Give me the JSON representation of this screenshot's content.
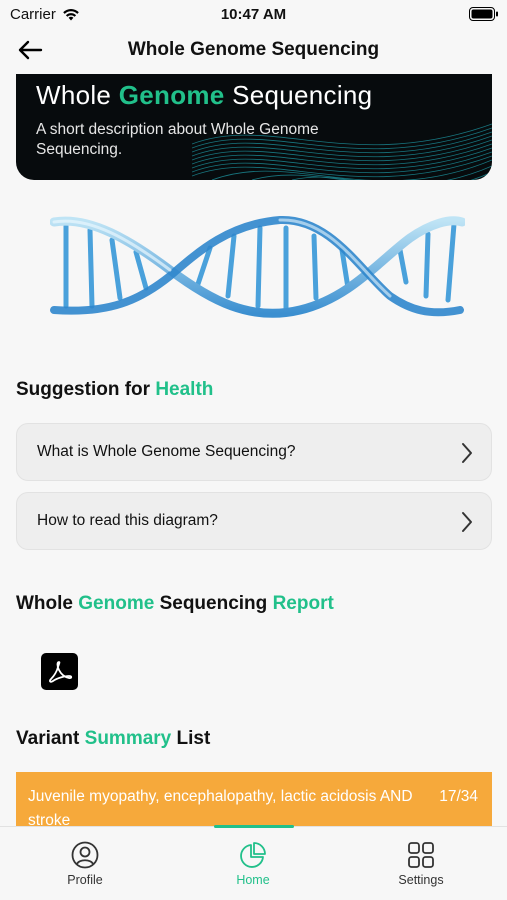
{
  "status_bar": {
    "carrier": "Carrier",
    "time": "10:47 AM"
  },
  "nav": {
    "title": "Whole Genome Sequencing",
    "back_icon": "arrow-left-icon"
  },
  "hero": {
    "title_part1": "Whole ",
    "title_accent": "Genome",
    "title_part2": " Sequencing",
    "description": "A short description about Whole Genome Sequencing."
  },
  "suggestion": {
    "title_part1": "Suggestion for ",
    "title_accent": "Health",
    "items": [
      {
        "label": "What is Whole Genome Sequencing?"
      },
      {
        "label": "How to read this diagram?"
      }
    ]
  },
  "report": {
    "title_part1": "Whole ",
    "title_accent1": "Genome",
    "title_part2": " Sequencing ",
    "title_accent2": "Report",
    "file_icon": "pdf-file-icon"
  },
  "variant_summary": {
    "title_part1": "Variant ",
    "title_accent": "Summary",
    "title_part2": " List",
    "items": [
      {
        "text": "Juvenile myopathy, encephalopathy, lactic acidosis AND stroke",
        "count": "17/34"
      }
    ]
  },
  "tabs": [
    {
      "label": "Profile",
      "icon": "person-circle-icon",
      "active": false
    },
    {
      "label": "Home",
      "icon": "pie-chart-icon",
      "active": true
    },
    {
      "label": "Settings",
      "icon": "grid-icon",
      "active": false
    }
  ],
  "colors": {
    "accent": "#21c08a",
    "variant_bg": "#f6a93b",
    "hero_bg": "#070b0d"
  }
}
